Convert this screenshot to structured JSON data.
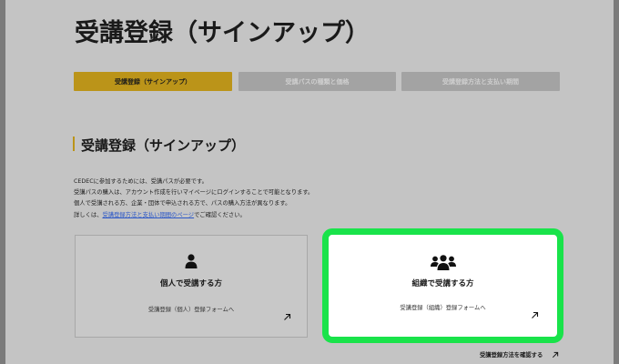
{
  "page": {
    "title": "受講登録（サインアップ）"
  },
  "tabs": [
    {
      "label": "受講登録（サインアップ）",
      "active": true
    },
    {
      "label": "受講パスの種類と価格",
      "active": false
    },
    {
      "label": "受講登録方法と支払い期間",
      "active": false
    }
  ],
  "section": {
    "heading": "受講登録（サインアップ）",
    "intro_lines": [
      "CEDECに参加するためには、受講パスが必要です。",
      "受講パスの購入は、アカウント作成を行いマイページにログインすることで可能となります。",
      "個人で受講される方、企業・団体で申込される方で、パスの購入方法が異なります。"
    ],
    "intro_last_prefix": "詳しくは、",
    "intro_link": "受講登録方法と支払い期間のページ",
    "intro_last_suffix": "でご確認ください。"
  },
  "cards": {
    "individual": {
      "icon": "person-icon",
      "title": "個人で受講する方",
      "subtitle": "受講登録（個人）登録フォームへ"
    },
    "organization": {
      "icon": "group-icon",
      "title": "組織で受講する方",
      "subtitle": "受講登録（組織）登録フォームへ"
    }
  },
  "footer": {
    "link_label": "受講登録方法を確認する"
  },
  "colors": {
    "accent": "#bb9419",
    "highlight": "#19e34a",
    "link": "#2b57c8"
  }
}
